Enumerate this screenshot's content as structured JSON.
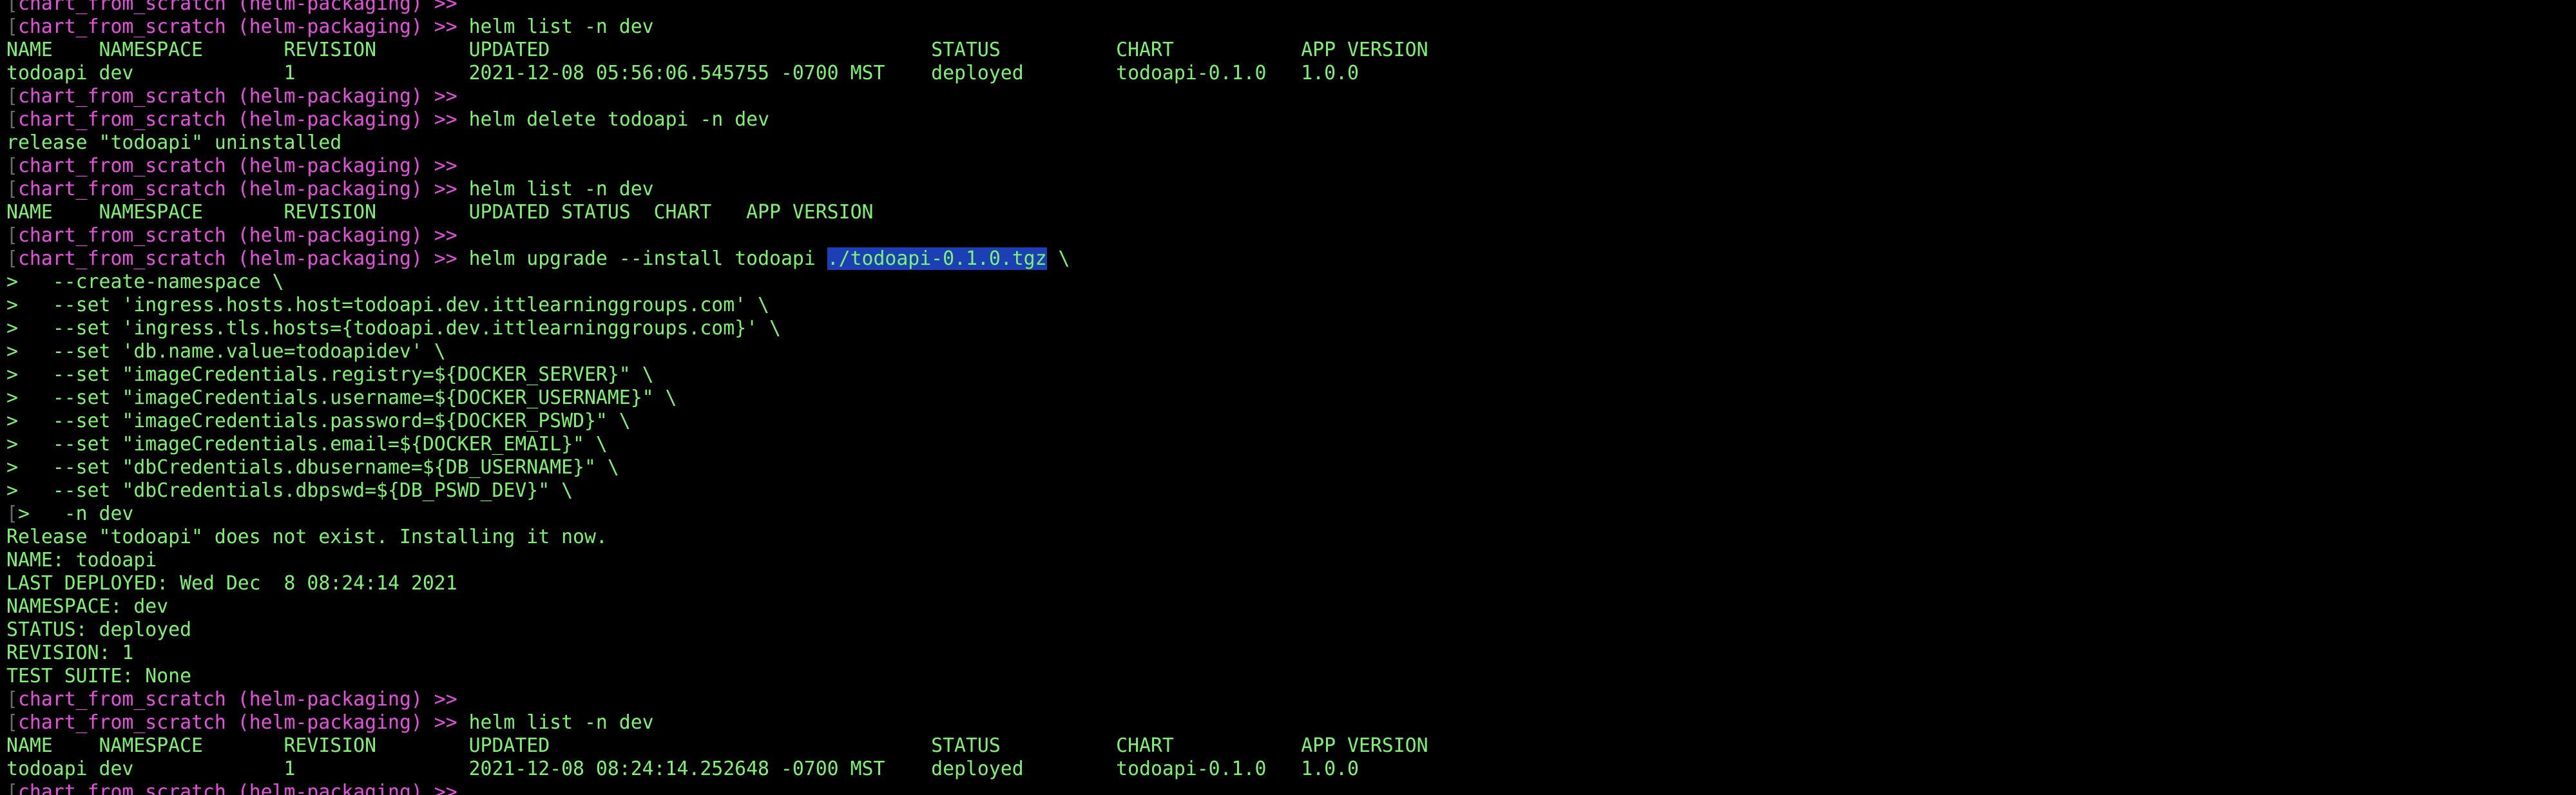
{
  "terminal": {
    "colors": {
      "background": "#000000",
      "text": "#7CF46E",
      "prompt": "#E94FE0",
      "selection": "#1C3FB5",
      "gutter_mark": "#6a6a6a"
    },
    "lines": [
      {
        "kind": "prompt",
        "segments": [
          {
            "t": "[",
            "c": "dim"
          },
          {
            "t": "chart_from_scratch (helm-packaging) >>",
            "c": "magenta"
          }
        ]
      },
      {
        "kind": "prompt",
        "segments": [
          {
            "t": "[",
            "c": "dim"
          },
          {
            "t": "chart_from_scratch (helm-packaging) >>",
            "c": "magenta"
          },
          {
            "t": " helm list -n dev",
            "c": "green"
          }
        ]
      },
      {
        "kind": "output",
        "segments": [
          {
            "t": "NAME    NAMESPACE       REVISION        UPDATED                                 STATUS          CHART           APP VERSION",
            "c": "green"
          }
        ]
      },
      {
        "kind": "output",
        "segments": [
          {
            "t": "todoapi dev             1               2021-12-08 05:56:06.545755 -0700 MST    deployed        todoapi-0.1.0   1.0.0",
            "c": "green"
          }
        ]
      },
      {
        "kind": "prompt",
        "segments": [
          {
            "t": "[",
            "c": "dim"
          },
          {
            "t": "chart_from_scratch (helm-packaging) >>",
            "c": "magenta"
          }
        ]
      },
      {
        "kind": "prompt",
        "segments": [
          {
            "t": "[",
            "c": "dim"
          },
          {
            "t": "chart_from_scratch (helm-packaging) >>",
            "c": "magenta"
          },
          {
            "t": " helm delete todoapi -n dev",
            "c": "green"
          }
        ]
      },
      {
        "kind": "output",
        "segments": [
          {
            "t": "release \"todoapi\" uninstalled",
            "c": "green"
          }
        ]
      },
      {
        "kind": "prompt",
        "segments": [
          {
            "t": "[",
            "c": "dim"
          },
          {
            "t": "chart_from_scratch (helm-packaging) >>",
            "c": "magenta"
          }
        ]
      },
      {
        "kind": "prompt",
        "segments": [
          {
            "t": "[",
            "c": "dim"
          },
          {
            "t": "chart_from_scratch (helm-packaging) >>",
            "c": "magenta"
          },
          {
            "t": " helm list -n dev",
            "c": "green"
          }
        ]
      },
      {
        "kind": "output",
        "segments": [
          {
            "t": "NAME    NAMESPACE       REVISION        UPDATED STATUS  CHART   APP VERSION",
            "c": "green"
          }
        ]
      },
      {
        "kind": "prompt",
        "segments": [
          {
            "t": "[",
            "c": "dim"
          },
          {
            "t": "chart_from_scratch (helm-packaging) >>",
            "c": "magenta"
          }
        ]
      },
      {
        "kind": "prompt",
        "segments": [
          {
            "t": "[",
            "c": "dim"
          },
          {
            "t": "chart_from_scratch (helm-packaging) >>",
            "c": "magenta"
          },
          {
            "t": " helm upgrade --install todoapi ",
            "c": "green"
          },
          {
            "t": "./todoapi-0.1.0.tgz",
            "c": "green",
            "hl": true
          },
          {
            "t": " \\",
            "c": "green"
          }
        ]
      },
      {
        "kind": "output",
        "segments": [
          {
            "t": ">   --create-namespace \\",
            "c": "green"
          }
        ]
      },
      {
        "kind": "output",
        "segments": [
          {
            "t": ">   --set 'ingress.hosts.host=todoapi.dev.ittlearninggroups.com' \\",
            "c": "green"
          }
        ]
      },
      {
        "kind": "output",
        "segments": [
          {
            "t": ">   --set 'ingress.tls.hosts={todoapi.dev.ittlearninggroups.com}' \\",
            "c": "green"
          }
        ]
      },
      {
        "kind": "output",
        "segments": [
          {
            "t": ">   --set 'db.name.value=todoapidev' \\",
            "c": "green"
          }
        ]
      },
      {
        "kind": "output",
        "segments": [
          {
            "t": ">   --set \"imageCredentials.registry=${DOCKER_SERVER}\" \\",
            "c": "green"
          }
        ]
      },
      {
        "kind": "output",
        "segments": [
          {
            "t": ">   --set \"imageCredentials.username=${DOCKER_USERNAME}\" \\",
            "c": "green"
          }
        ]
      },
      {
        "kind": "output",
        "segments": [
          {
            "t": ">   --set \"imageCredentials.password=${DOCKER_PSWD}\" \\",
            "c": "green"
          }
        ]
      },
      {
        "kind": "output",
        "segments": [
          {
            "t": ">   --set \"imageCredentials.email=${DOCKER_EMAIL}\" \\",
            "c": "green"
          }
        ]
      },
      {
        "kind": "output",
        "segments": [
          {
            "t": ">   --set \"dbCredentials.dbusername=${DB_USERNAME}\" \\",
            "c": "green"
          }
        ]
      },
      {
        "kind": "output",
        "segments": [
          {
            "t": ">   --set \"dbCredentials.dbpswd=${DB_PSWD_DEV}\" \\",
            "c": "green"
          }
        ]
      },
      {
        "kind": "output",
        "segments": [
          {
            "t": "[",
            "c": "dim"
          },
          {
            "t": ">   -n dev",
            "c": "green"
          }
        ]
      },
      {
        "kind": "output",
        "segments": [
          {
            "t": "Release \"todoapi\" does not exist. Installing it now.",
            "c": "green"
          }
        ]
      },
      {
        "kind": "output",
        "segments": [
          {
            "t": "NAME: todoapi",
            "c": "green"
          }
        ]
      },
      {
        "kind": "output",
        "segments": [
          {
            "t": "LAST DEPLOYED: Wed Dec  8 08:24:14 2021",
            "c": "green"
          }
        ]
      },
      {
        "kind": "output",
        "segments": [
          {
            "t": "NAMESPACE: dev",
            "c": "green"
          }
        ]
      },
      {
        "kind": "output",
        "segments": [
          {
            "t": "STATUS: deployed",
            "c": "green"
          }
        ]
      },
      {
        "kind": "output",
        "segments": [
          {
            "t": "REVISION: 1",
            "c": "green"
          }
        ]
      },
      {
        "kind": "output",
        "segments": [
          {
            "t": "TEST SUITE: None",
            "c": "green"
          }
        ]
      },
      {
        "kind": "prompt",
        "segments": [
          {
            "t": "[",
            "c": "dim"
          },
          {
            "t": "chart_from_scratch (helm-packaging) >>",
            "c": "magenta"
          }
        ]
      },
      {
        "kind": "prompt",
        "segments": [
          {
            "t": "[",
            "c": "dim"
          },
          {
            "t": "chart_from_scratch (helm-packaging) >>",
            "c": "magenta"
          },
          {
            "t": " helm list -n dev",
            "c": "green"
          }
        ]
      },
      {
        "kind": "output",
        "segments": [
          {
            "t": "NAME    NAMESPACE       REVISION        UPDATED                                 STATUS          CHART           APP VERSION",
            "c": "green"
          }
        ]
      },
      {
        "kind": "output",
        "segments": [
          {
            "t": "todoapi dev             1               2021-12-08 08:24:14.252648 -0700 MST    deployed        todoapi-0.1.0   1.0.0",
            "c": "green"
          }
        ]
      },
      {
        "kind": "prompt",
        "segments": [
          {
            "t": "[",
            "c": "dim"
          },
          {
            "t": "chart_from_scratch (helm-packaging) >>",
            "c": "magenta"
          }
        ]
      }
    ]
  }
}
